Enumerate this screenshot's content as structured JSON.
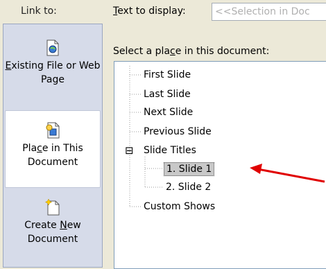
{
  "link_to": {
    "label": "Link to:"
  },
  "sidebar": {
    "items": [
      {
        "label_pre": "",
        "label_ul": "E",
        "label_post": "xisting File or Web Page",
        "icon": "existing-file-icon"
      },
      {
        "label_pre": "Pla",
        "label_ul": "c",
        "label_post": "e in This Document",
        "icon": "place-in-document-icon"
      },
      {
        "label_pre": "Create ",
        "label_ul": "N",
        "label_post": "ew Document",
        "icon": "new-document-icon"
      }
    ]
  },
  "display": {
    "label_ul": "T",
    "label_rest": "ext to display:",
    "value": "<<Selection in Doc"
  },
  "select": {
    "label_pre": "Select a pla",
    "label_ul": "c",
    "label_post": "e in this document:"
  },
  "tree": {
    "first": "First Slide",
    "last": "Last Slide",
    "next": "Next Slide",
    "previous": "Previous Slide",
    "titles": "Slide Titles",
    "collapse": "⊟",
    "slide1": "1. Slide 1",
    "slide2": "2. Slide 2",
    "shows": "Custom Shows"
  },
  "annotation_color": "#e00000"
}
